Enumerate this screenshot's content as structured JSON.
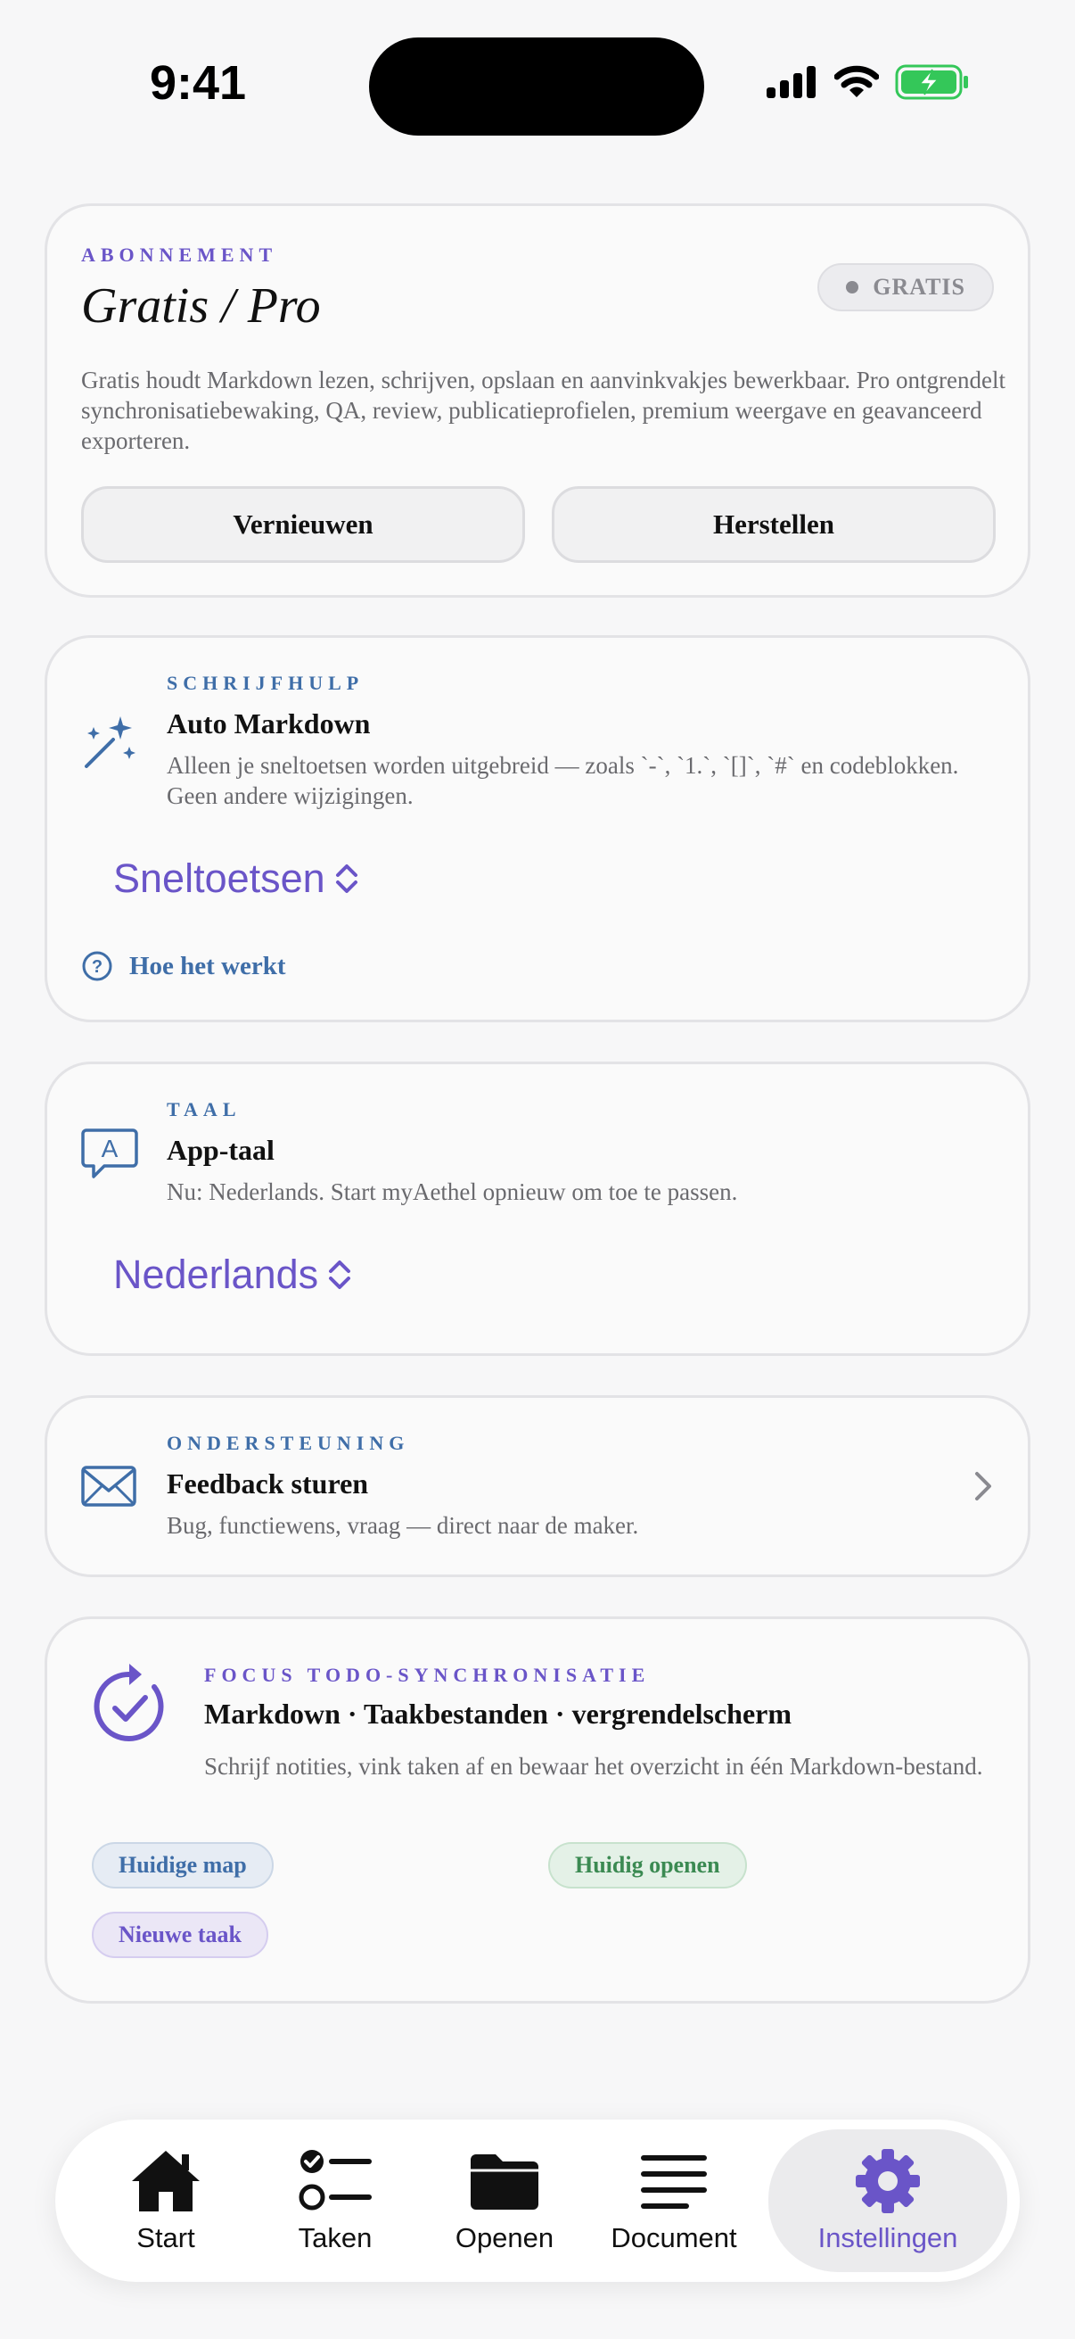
{
  "status_bar": {
    "time": "9:41"
  },
  "subscription": {
    "eyebrow": "ABONNEMENT",
    "title": "Gratis / Pro",
    "badge": "GRATIS",
    "description": "Gratis houdt Markdown lezen, schrijven, opslaan en aanvinkvakjes bewerkbaar. Pro ontgrendelt synchronisatiebewaking, QA, review, publicatieprofielen, premium weergave en geavanceerd exporteren.",
    "renew_label": "Vernieuwen",
    "restore_label": "Herstellen"
  },
  "writing": {
    "eyebrow": "SCHRIJFHULP",
    "title": "Auto Markdown",
    "description": "Alleen je sneltoetsen worden uitgebreid — zoals `-`, `1.`, `[]`, `#` en codeblokken. Geen andere wijzigingen.",
    "picker": "Sneltoetsen",
    "help": "Hoe het werkt"
  },
  "language": {
    "eyebrow": "TAAL",
    "title": "App-taal",
    "description": "Nu: Nederlands. Start myAethel opnieuw om toe te passen.",
    "picker": "Nederlands"
  },
  "support": {
    "eyebrow": "ONDERSTEUNING",
    "title": "Feedback sturen",
    "description": "Bug, functiewens, vraag — direct naar de maker."
  },
  "focus": {
    "eyebrow": "FOCUS TODO-SYNCHRONISATIE",
    "title": "Markdown · Taakbestanden · vergrendelscherm",
    "description": "Schrijf notities, vink taken af en bewaar het overzicht in één Markdown-bestand.",
    "chips": [
      "Huidige map",
      "Huidig openen",
      "Nieuwe taak"
    ]
  },
  "tabbar": {
    "items": [
      {
        "label": "Start",
        "icon": "house-icon"
      },
      {
        "label": "Taken",
        "icon": "checklist-icon"
      },
      {
        "label": "Openen",
        "icon": "folder-icon"
      },
      {
        "label": "Document",
        "icon": "text-lines-icon"
      },
      {
        "label": "Instellingen",
        "icon": "gear-icon"
      }
    ],
    "active": "Instellingen"
  },
  "colors": {
    "accent": "#6a55c8",
    "blue": "#3f6ea8",
    "green": "#3b8a52",
    "battery": "#34c759"
  }
}
